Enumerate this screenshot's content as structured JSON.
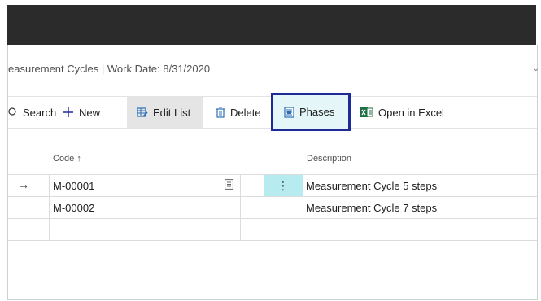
{
  "caption": "easurement Cycles | Work Date: 8/31/2020",
  "actions": {
    "search": "Search",
    "new": "New",
    "edit_list": "Edit List",
    "delete": "Delete",
    "phases": "Phases",
    "open_excel": "Open in Excel"
  },
  "columns": {
    "code": "Code ↑",
    "description": "Description"
  },
  "rows": [
    {
      "marker": "→",
      "code": "M-00001",
      "description": "Measurement Cycle 5 steps",
      "dots": "⋮"
    },
    {
      "marker": "",
      "code": "M-00002",
      "description": "Measurement Cycle 7 steps",
      "dots": ""
    }
  ],
  "colors": {
    "topbar": "#2b2b2b",
    "phases_border": "#1f2a99",
    "phases_bg": "#e4f6f8",
    "selected_cell": "#b6ecf0",
    "excel_green": "#1e7145"
  }
}
